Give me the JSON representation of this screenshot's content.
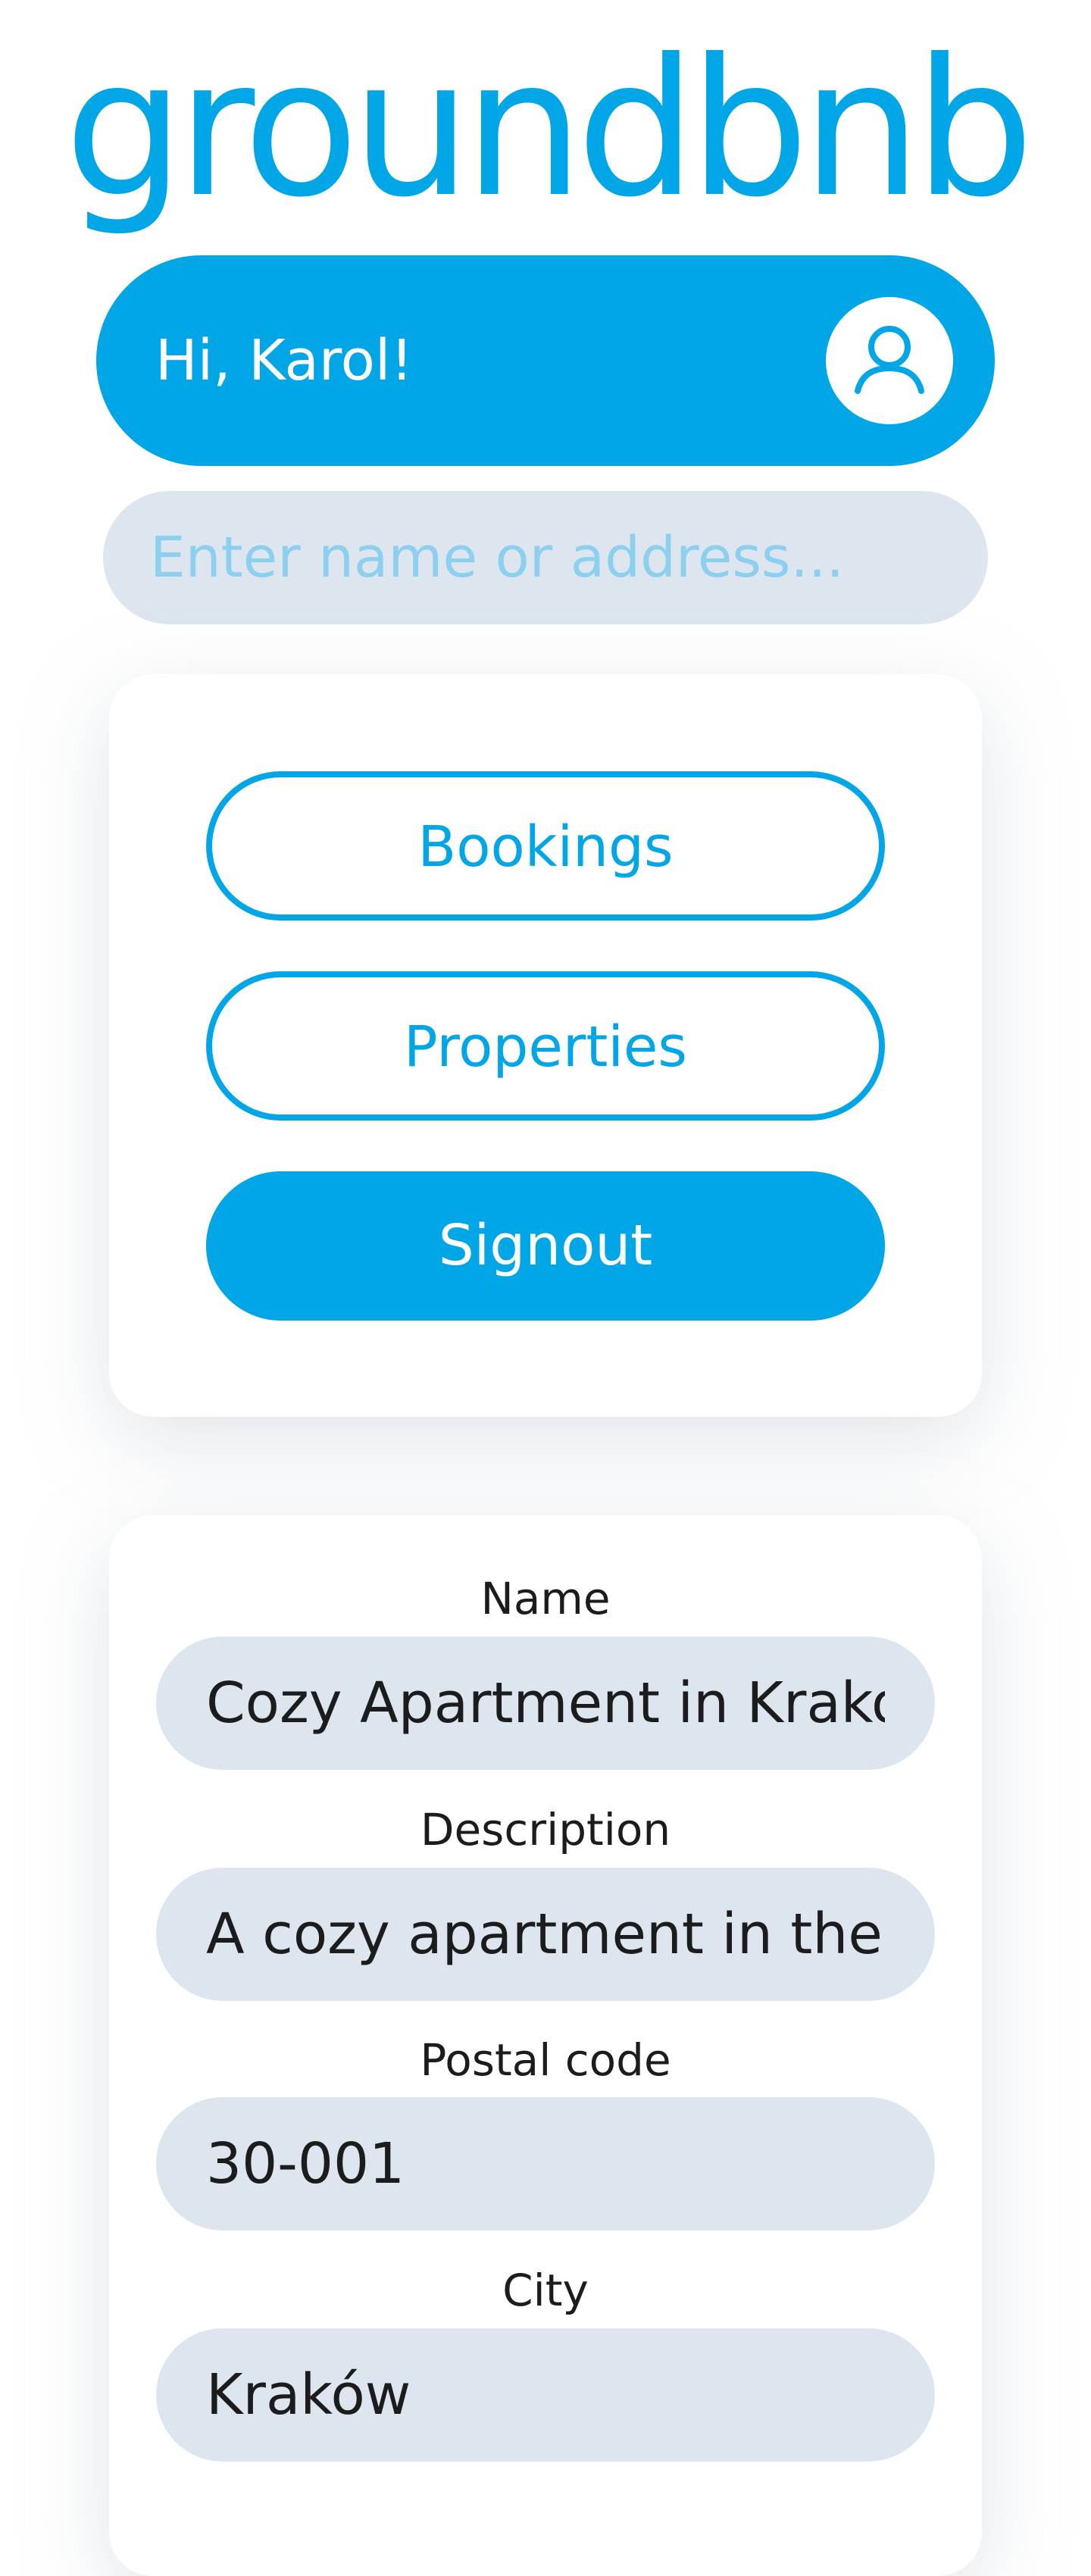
{
  "app": {
    "logo_text": "groundbnb",
    "brand_color": "#00a6e6"
  },
  "header": {
    "greeting": "Hi, Karol!",
    "avatar_icon": "user-circle-icon"
  },
  "search": {
    "placeholder": "Enter name or address...",
    "value": ""
  },
  "nav": {
    "bookings_label": "Bookings",
    "properties_label": "Properties",
    "signout_label": "Signout"
  },
  "form": {
    "name_label": "Name",
    "name_value": "Cozy Apartment in Kraków",
    "description_label": "Description",
    "description_value": "A cozy apartment in the heart of Kraków",
    "postal_label": "Postal code",
    "postal_value": "30-001",
    "city_label": "City",
    "city_value": "Kraków"
  }
}
